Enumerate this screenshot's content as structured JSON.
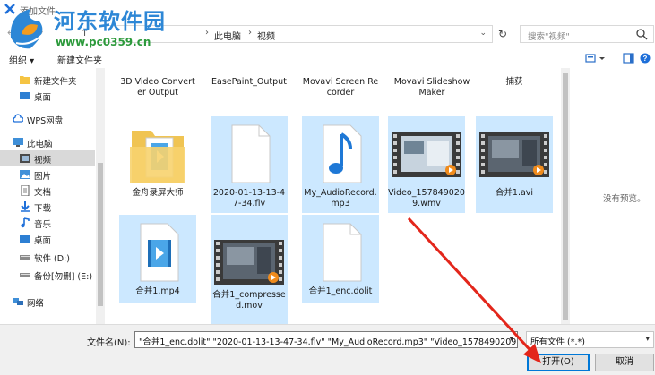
{
  "window": {
    "title": "添加文件",
    "icon": "app-icon"
  },
  "watermark": {
    "name": "河东软件园",
    "url": "www.pc0359.cn"
  },
  "address": {
    "breadcrumb": [
      "此电脑",
      "视频"
    ],
    "search_placeholder": "搜索\"视频\""
  },
  "toolbar": {
    "organize": "组织 ▾",
    "new_folder": "新建文件夹"
  },
  "sidebar": {
    "items": [
      {
        "label": "新建文件夹",
        "icon": "folder-icon"
      },
      {
        "label": "桌面",
        "icon": "desktop-icon"
      },
      {
        "label": "WPS网盘",
        "icon": "cloud-icon"
      },
      {
        "label": "此电脑",
        "icon": "computer-icon"
      },
      {
        "label": "视频",
        "icon": "video-icon"
      },
      {
        "label": "图片",
        "icon": "picture-icon"
      },
      {
        "label": "文档",
        "icon": "document-icon"
      },
      {
        "label": "下载",
        "icon": "download-icon"
      },
      {
        "label": "音乐",
        "icon": "music-icon"
      },
      {
        "label": "桌面",
        "icon": "desktop-icon"
      },
      {
        "label": "软件 (D:)",
        "icon": "drive-icon"
      },
      {
        "label": "备份[勿删] (E:)",
        "icon": "drive-icon"
      },
      {
        "label": "网络",
        "icon": "network-icon"
      }
    ]
  },
  "files": {
    "row1": [
      {
        "name": "3D Video Converter Output",
        "type": "folder"
      },
      {
        "name": "EasePaint_Output",
        "type": "folder"
      },
      {
        "name": "Movavi Screen Recorder",
        "type": "folder"
      },
      {
        "name": "Movavi Slideshow Maker",
        "type": "folder"
      },
      {
        "name": "捕获",
        "type": "folder"
      }
    ],
    "row2": [
      {
        "name": "金舟录屏大师",
        "type": "video-folder"
      },
      {
        "name": "2020-01-13-13-47-34.flv",
        "type": "blank-file"
      },
      {
        "name": "My_AudioRecord.mp3",
        "type": "audio"
      },
      {
        "name": "Video_1578490209.wmv",
        "type": "video-thumb"
      },
      {
        "name": "合并1.avi",
        "type": "video-thumb"
      }
    ],
    "row3": [
      {
        "name": "合并1.mp4",
        "type": "video-file"
      },
      {
        "name": "合并1_compressed.mov",
        "type": "video-thumb"
      },
      {
        "name": "合并1_enc.dolit",
        "type": "blank-file"
      }
    ]
  },
  "preview": {
    "text": "没有预览。"
  },
  "footer": {
    "filename_label": "文件名(N):",
    "filename_value": "\"合并1_enc.dolit\" \"2020-01-13-13-47-34.flv\" \"My_AudioRecord.mp3\" \"Video_1578490209.",
    "filetype_value": "所有文件 (*.*)",
    "open_label": "打开(O)",
    "cancel_label": "取消"
  }
}
